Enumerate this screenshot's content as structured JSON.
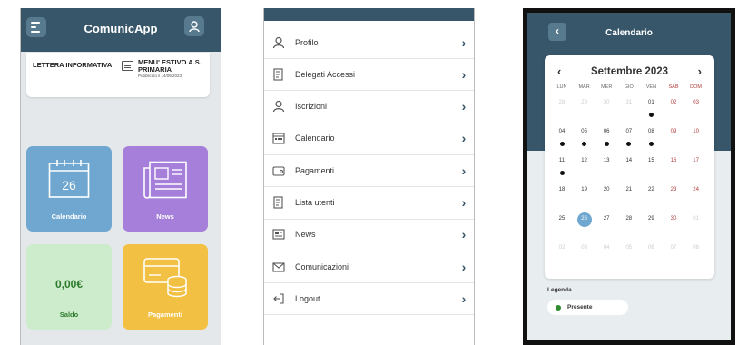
{
  "screen1": {
    "app_title": "ComunicApp",
    "card_left": "LETTERA INFORMATIVA",
    "card_right_line1": "MENU' ESTIVO A.S.",
    "card_right_line2": "PRIMARIA",
    "card_right_date": "Pubblicato il 14/09/2023",
    "calendar_day": "26",
    "tiles": {
      "calendar": "Calendario",
      "news": "News",
      "saldo_value": "0,00€",
      "saldo": "Saldo",
      "payments": "Pagamenti"
    },
    "colors": {
      "header": "#37566a",
      "calendar": "#6fa7d0",
      "news": "#a57fd9",
      "saldo": "#cdeccc",
      "payments": "#f2c043"
    }
  },
  "screen2": {
    "menu": [
      {
        "label": "Profilo",
        "icon": "user-icon"
      },
      {
        "label": "Delegati Accessi",
        "icon": "document-icon"
      },
      {
        "label": "Iscrizioni",
        "icon": "user-icon"
      },
      {
        "label": "Calendario",
        "icon": "calendar-icon"
      },
      {
        "label": "Pagamenti",
        "icon": "wallet-icon"
      },
      {
        "label": "Lista utenti",
        "icon": "document-icon"
      },
      {
        "label": "News",
        "icon": "news-icon"
      },
      {
        "label": "Comunicazioni",
        "icon": "mail-icon"
      },
      {
        "label": "Logout",
        "icon": "logout-icon"
      }
    ]
  },
  "screen3": {
    "title": "Calendario",
    "month": "Settembre 2023",
    "weekdays": [
      "LUN",
      "MAR",
      "MER",
      "GIO",
      "VEN",
      "SAB",
      "DOM"
    ],
    "weeks": [
      [
        "28",
        "29",
        "30",
        "31",
        "01",
        "02",
        "03"
      ],
      [
        "04",
        "05",
        "06",
        "07",
        "08",
        "09",
        "10"
      ],
      [
        "11",
        "12",
        "13",
        "14",
        "15",
        "16",
        "17"
      ],
      [
        "18",
        "19",
        "20",
        "21",
        "22",
        "23",
        "24"
      ],
      [
        "25",
        "26",
        "27",
        "28",
        "29",
        "30",
        "01"
      ],
      [
        "02",
        "03",
        "04",
        "05",
        "06",
        "07",
        "08"
      ]
    ],
    "muted_days": [
      [
        0,
        0
      ],
      [
        0,
        1
      ],
      [
        0,
        2
      ],
      [
        0,
        3
      ],
      [
        4,
        6
      ],
      [
        5,
        0
      ],
      [
        5,
        1
      ],
      [
        5,
        2
      ],
      [
        5,
        3
      ],
      [
        5,
        4
      ],
      [
        5,
        5
      ],
      [
        5,
        6
      ]
    ],
    "present_days": [
      "01",
      "04",
      "05",
      "06",
      "07",
      "08",
      "11"
    ],
    "today": "26",
    "legend_title": "Legenda",
    "legend_item": "Presente"
  }
}
